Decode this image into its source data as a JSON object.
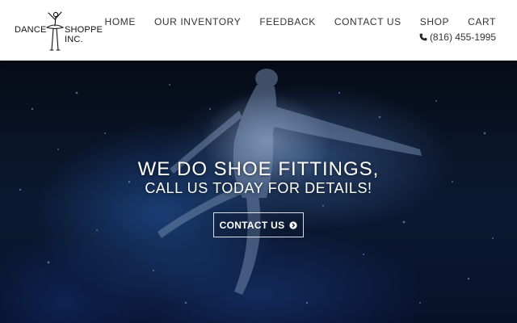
{
  "brand": {
    "name_left": "DANCE",
    "name_right": "SHOPPE INC."
  },
  "nav": {
    "items": [
      {
        "label": "HOME"
      },
      {
        "label": "OUR INVENTORY"
      },
      {
        "label": "FEEDBACK"
      },
      {
        "label": "CONTACT US"
      },
      {
        "label": "SHOP"
      },
      {
        "label": "CART"
      }
    ],
    "phone": "(816) 455-1995",
    "phone_icon": "phone-icon"
  },
  "hero": {
    "headline": "WE DO SHOE FITTINGS,",
    "subline": "CALL US TODAY FOR DETAILS!",
    "cta_label": "CONTACT US",
    "cta_icon": "chevron-right-circle-icon"
  },
  "colors": {
    "header_bg": "#ffffff",
    "nav_text": "#333333",
    "hero_text": "#ffffff"
  }
}
